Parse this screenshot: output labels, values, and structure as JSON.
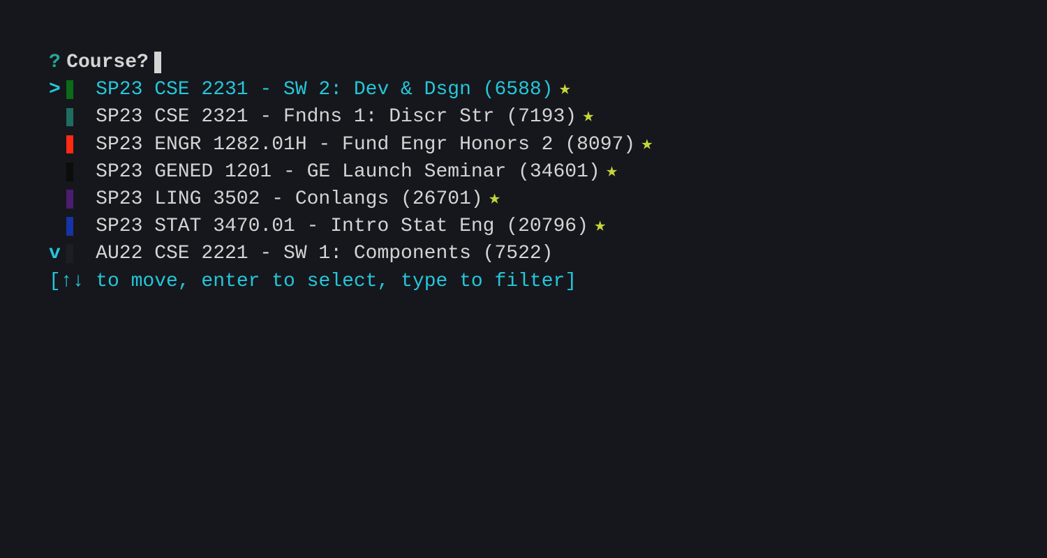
{
  "prompt": {
    "mark": "?",
    "label": "Course?"
  },
  "items": [
    {
      "pointer": ">",
      "color": "green",
      "label": "SP23 CSE 2231 - SW 2: Dev & Dsgn (6588)",
      "favorite": true,
      "selected": true
    },
    {
      "pointer": " ",
      "color": "teal",
      "label": "SP23 CSE 2321 - Fndns 1: Discr Str (7193)",
      "favorite": true,
      "selected": false
    },
    {
      "pointer": " ",
      "color": "red",
      "label": "SP23 ENGR 1282.01H - Fund Engr Honors 2 (8097)",
      "favorite": true,
      "selected": false
    },
    {
      "pointer": " ",
      "color": "black",
      "label": "SP23 GENED 1201 - GE Launch Seminar (34601)",
      "favorite": true,
      "selected": false
    },
    {
      "pointer": " ",
      "color": "purple",
      "label": "SP23 LING 3502 - Conlangs (26701)",
      "favorite": true,
      "selected": false
    },
    {
      "pointer": " ",
      "color": "blue",
      "label": "SP23 STAT 3470.01 - Intro Stat Eng (20796)",
      "favorite": true,
      "selected": false
    },
    {
      "pointer": "v",
      "color": "dark",
      "label": "AU22 CSE 2221 - SW 1: Components (7522)",
      "favorite": false,
      "selected": false
    }
  ],
  "hint": "[↑↓ to move, enter to select, type to filter]",
  "star_glyph": "★"
}
